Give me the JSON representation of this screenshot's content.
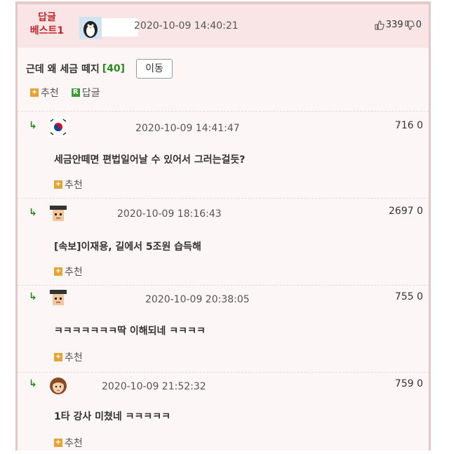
{
  "header": {
    "best_label_line1": "답글",
    "best_label_line2": "베스트1",
    "date": "2020-10-09 14:40:21",
    "upvotes": "339",
    "downvotes": "0"
  },
  "post": {
    "title": "근데 왜 세금 떼지",
    "comment_count": "[40]",
    "move_button": "이동"
  },
  "actions": {
    "recommend": "추천",
    "reply": "답글"
  },
  "comments": [
    {
      "date": "2020-10-09 14:41:47",
      "votes": "716 0",
      "text": "세금안떼면 편법일어날 수 있어서 그러는걸듯?",
      "recommend": "추천",
      "avatar": "korea-flag"
    },
    {
      "date": "2020-10-09 18:16:43",
      "votes": "2697 0",
      "text": "[속보]이재용, 길에서 5조원 습득해",
      "recommend": "추천",
      "avatar": "graduate"
    },
    {
      "date": "2020-10-09 20:38:05",
      "votes": "755 0",
      "text": "ㅋㅋㅋㅋㅋㅋㅋ딱 이해되네 ㅋㅋㅋㅋ",
      "recommend": "추천",
      "avatar": "graduate"
    },
    {
      "date": "2020-10-09 21:52:32",
      "votes": "759 0",
      "text": "1타 강사 미쳤네 ㅋㅋㅋㅋㅋ",
      "recommend": "추천",
      "avatar": "girl"
    }
  ],
  "colors": {
    "header_bg": "#f9e5e6",
    "accent_red": "#c3262b",
    "accent_green": "#2a8a1c",
    "plus_square": "#e4a432"
  }
}
